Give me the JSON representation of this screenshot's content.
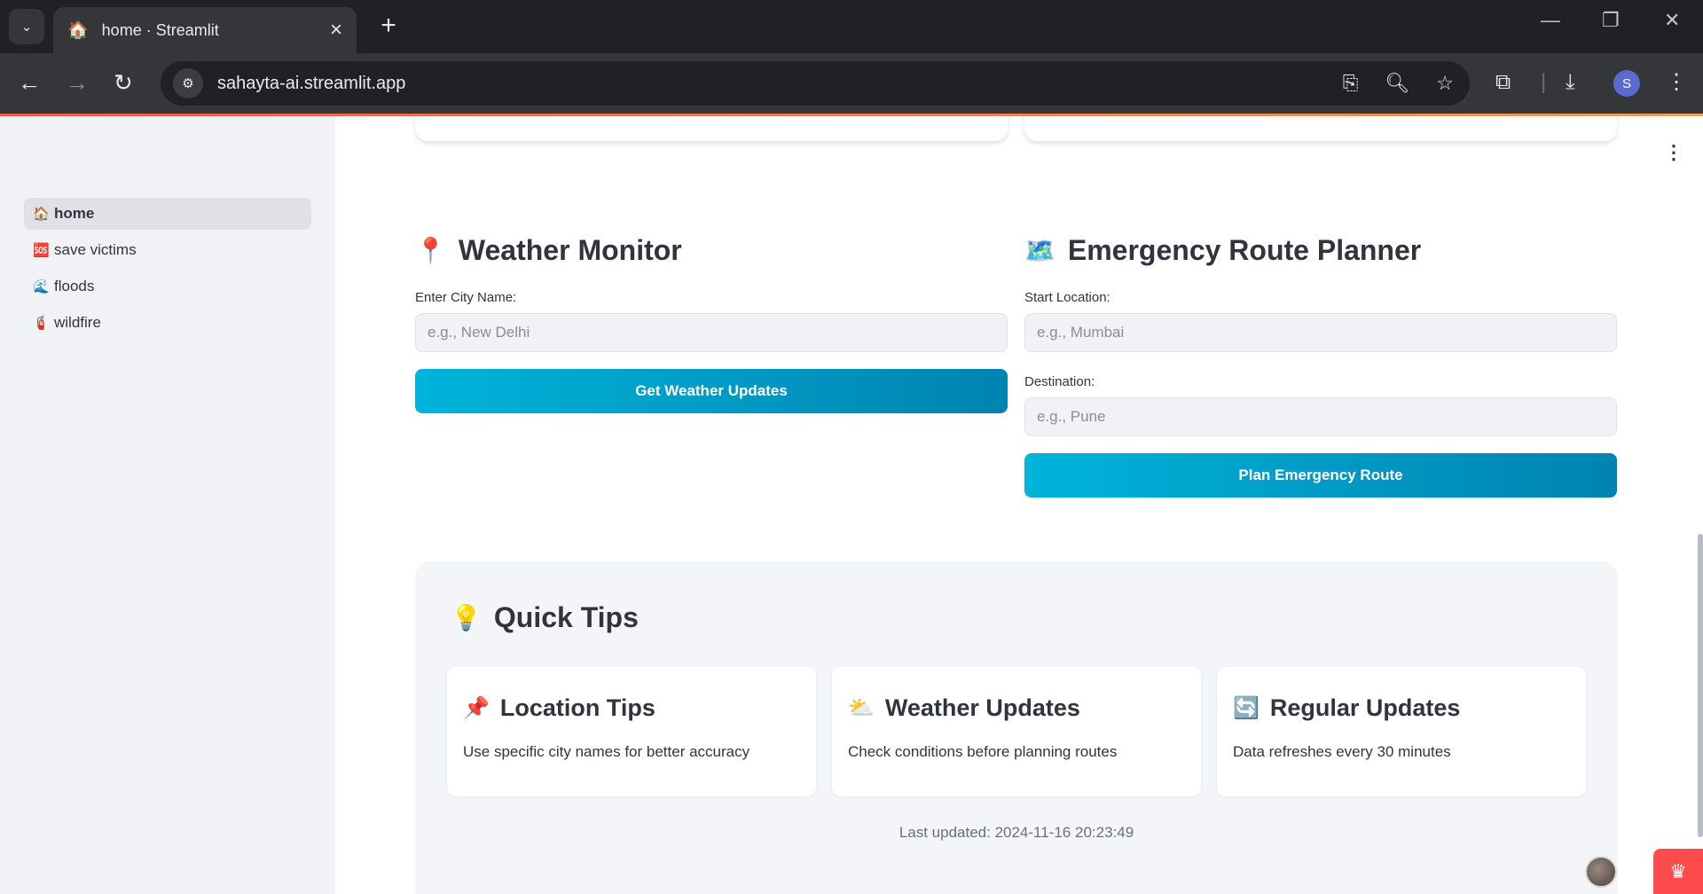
{
  "browser": {
    "tab_title": "home · Streamlit",
    "tab_favicon": "🏠",
    "url": "sahayta-ai.streamlit.app",
    "profile_initial": "S"
  },
  "sidebar": {
    "items": [
      {
        "emoji": "🏠",
        "label": "home",
        "active": true
      },
      {
        "emoji": "🆘",
        "label": "save victims",
        "active": false
      },
      {
        "emoji": "🌊",
        "label": "floods",
        "active": false
      },
      {
        "emoji": "🧯",
        "label": "wildfire",
        "active": false
      }
    ]
  },
  "weather": {
    "emoji": "📍",
    "heading": "Weather Monitor",
    "city_label": "Enter City Name:",
    "city_placeholder": "e.g., New Delhi",
    "button": "Get Weather Updates"
  },
  "route": {
    "emoji": "🗺️",
    "heading": "Emergency Route Planner",
    "start_label": "Start Location:",
    "start_placeholder": "e.g., Mumbai",
    "dest_label": "Destination:",
    "dest_placeholder": "e.g., Pune",
    "button": "Plan Emergency Route"
  },
  "tips": {
    "emoji": "💡",
    "heading": "Quick Tips",
    "cards": [
      {
        "emoji": "📌",
        "title": "Location Tips",
        "text": "Use specific city names for better accuracy"
      },
      {
        "emoji": "⛅",
        "title": "Weather Updates",
        "text": "Check conditions before planning routes"
      },
      {
        "emoji": "🔄",
        "title": "Regular Updates",
        "text": "Data refreshes every 30 minutes"
      }
    ],
    "last_updated": "Last updated: 2024-11-16 20:23:49"
  }
}
